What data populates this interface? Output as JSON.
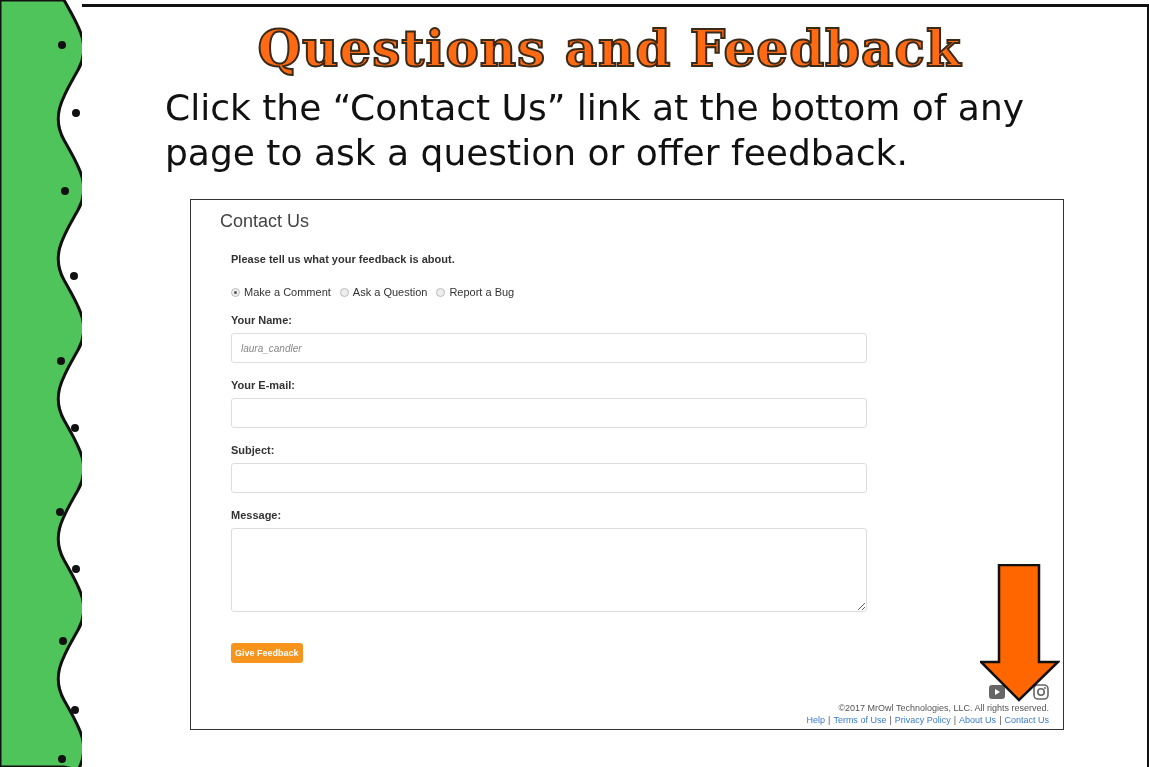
{
  "slide": {
    "title": "Questions and Feedback",
    "instruction": "Click the “Contact Us” link at the bottom of any page to ask a question or offer feedback."
  },
  "screenshot": {
    "heading": "Contact Us",
    "prompt": "Please tell us what your feedback is about.",
    "feedback_types": [
      {
        "label": "Make a Comment",
        "selected": true
      },
      {
        "label": "Ask a Question",
        "selected": false
      },
      {
        "label": "Report a Bug",
        "selected": false
      }
    ],
    "fields": [
      {
        "kind": "input",
        "label": "Your Name:",
        "placeholder": "laura_candler"
      },
      {
        "kind": "input",
        "label": "Your E-mail:"
      },
      {
        "kind": "input",
        "label": "Subject:"
      },
      {
        "kind": "textarea",
        "label": "Message:"
      }
    ],
    "submit_button": "Give Feedback",
    "copyright": "©2017 MrOwl Technologies, LLC. All rights reserved.",
    "link_separator": "|",
    "footer_links": [
      "Help",
      "Terms of Use",
      "Privacy Policy",
      "About Us",
      "Contact Us"
    ]
  }
}
